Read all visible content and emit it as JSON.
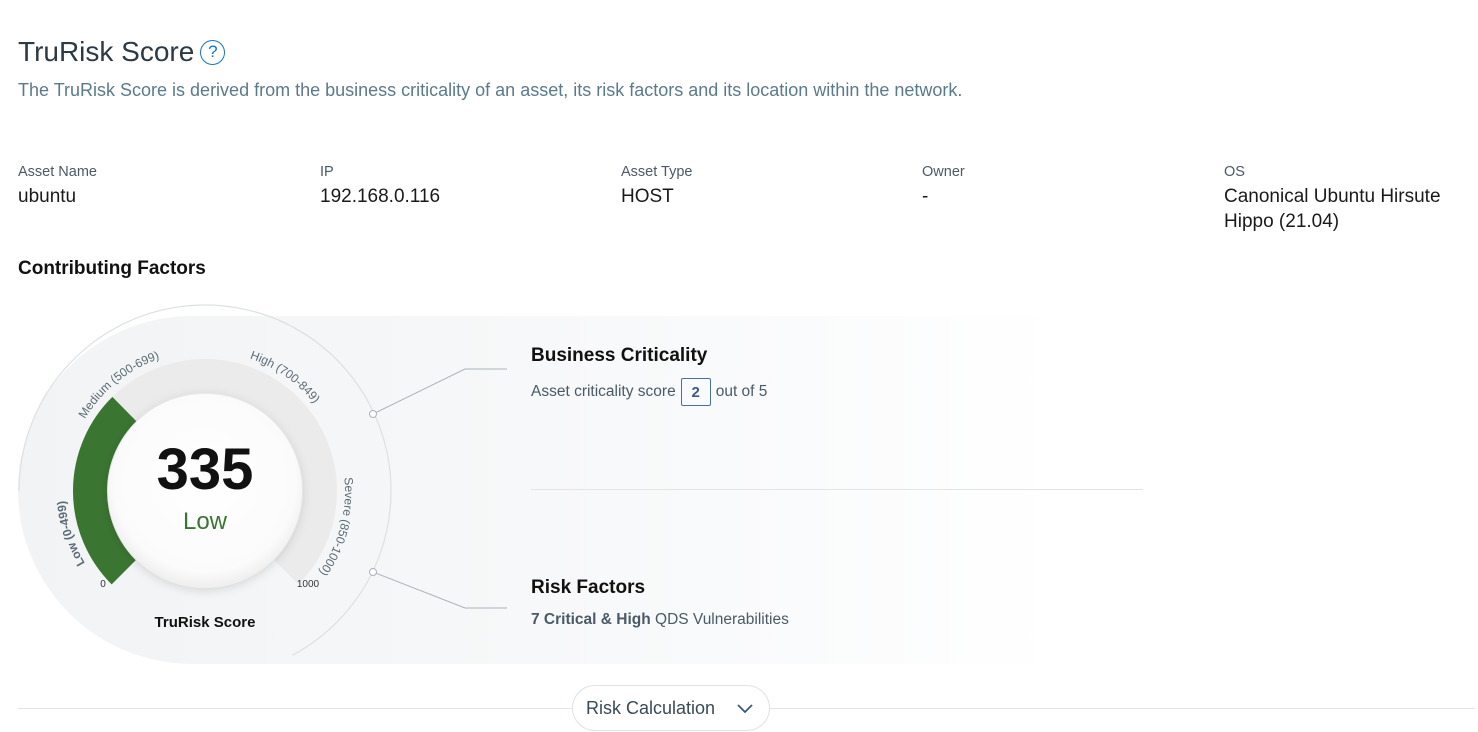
{
  "header": {
    "title": "TruRisk Score",
    "help_icon": "question-circle-icon",
    "subtitle": "The TruRisk Score is derived from the business criticality of an asset, its risk factors and its location within the network."
  },
  "asset": {
    "name_label": "Asset Name",
    "name": "ubuntu",
    "ip_label": "IP",
    "ip": "192.168.0.116",
    "type_label": "Asset Type",
    "type": "HOST",
    "owner_label": "Owner",
    "owner": "-",
    "os_label": "OS",
    "os_line1": "Canonical Ubuntu Hirsute",
    "os_line2": "Hippo (21.04)"
  },
  "contributing_title": "Contributing Factors",
  "gauge": {
    "score": "335",
    "rating": "Low",
    "caption": "TruRisk Score",
    "min_label": "0",
    "max_label": "1000",
    "score_value": 335,
    "score_max": 1000,
    "fill_color": "#3b7532",
    "bands": [
      {
        "label": "Low (0-499)"
      },
      {
        "label": "Medium (500-699)"
      },
      {
        "label": "High (700-849)"
      },
      {
        "label": "Severe (850-1000)"
      }
    ]
  },
  "business": {
    "title": "Business Criticality",
    "prefix": "Asset criticality score",
    "score": "2",
    "suffix": "out of 5"
  },
  "risk": {
    "title": "Risk Factors",
    "strong": "7 Critical & High",
    "rest": "QDS Vulnerabilities"
  },
  "footer": {
    "risk_calc_label": "Risk Calculation",
    "chevron_icon": "chevron-down-icon"
  }
}
